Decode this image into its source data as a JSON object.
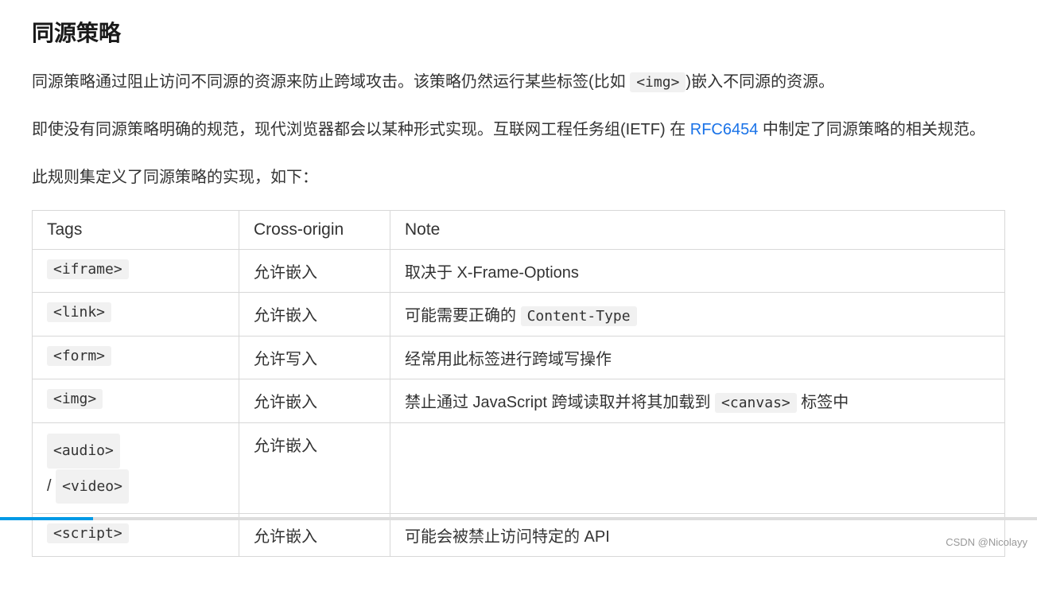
{
  "heading": "同源策略",
  "para1_a": "同源策略通过阻止访问不同源的资源来防止跨域攻击。该策略仍然运行某些标签(比如 ",
  "para1_code": "<img>",
  "para1_b": ")嵌入不同源的资源。",
  "para2_a": "即使没有同源策略明确的规范，现代浏览器都会以某种形式实现。互联网工程任务组(IETF) 在 ",
  "para2_link": "RFC6454",
  "para2_b": " 中制定了同源策略的相关规范。",
  "para3": "此规则集定义了同源策略的实现，如下：",
  "table": {
    "headers": {
      "h1": "Tags",
      "h2": "Cross-origin",
      "h3": "Note"
    },
    "rows": [
      {
        "tag": "<iframe>",
        "cross": "允许嵌入",
        "note_a": "取决于 X-Frame-Options",
        "note_code": "",
        "note_b": ""
      },
      {
        "tag": "<link>",
        "cross": "允许嵌入",
        "note_a": "可能需要正确的 ",
        "note_code": "Content-Type",
        "note_b": ""
      },
      {
        "tag": "<form>",
        "cross": "允许写入",
        "note_a": "经常用此标签进行跨域写操作",
        "note_code": "",
        "note_b": ""
      },
      {
        "tag": "<img>",
        "cross": "允许嵌入",
        "note_a": "禁止通过 JavaScript 跨域读取并将其加载到 ",
        "note_code": "<canvas>",
        "note_b": " 标签中"
      },
      {
        "tag_a": "<audio>",
        "sep": "/ ",
        "tag_b": "<video>",
        "cross": "允许嵌入",
        "note_a": "",
        "note_code": "",
        "note_b": ""
      },
      {
        "tag": "<script>",
        "cross": "允许嵌入",
        "note_a": "可能会被禁止访问特定的 API",
        "note_code": "",
        "note_b": ""
      }
    ]
  },
  "progress_percent": 9,
  "watermark": "CSDN @Nicolayy"
}
